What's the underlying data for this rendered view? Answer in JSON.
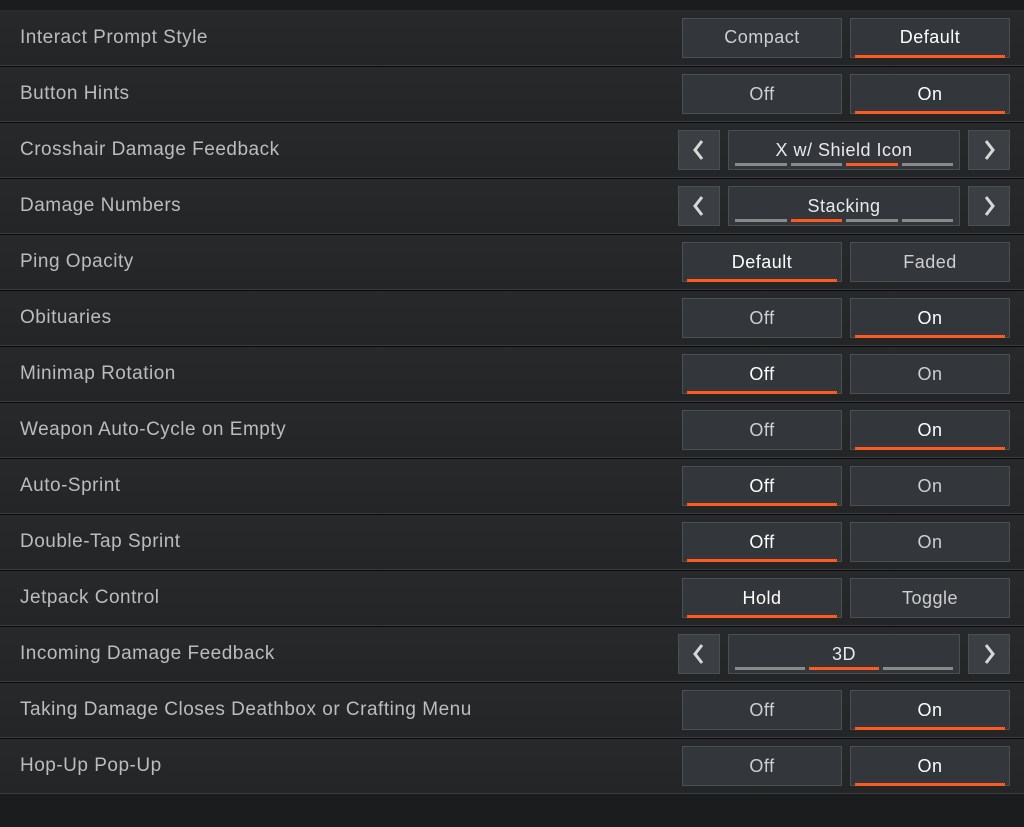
{
  "settings": [
    {
      "id": "interact-prompt-style",
      "label": "Interact Prompt Style",
      "type": "toggle2",
      "options": [
        "Compact",
        "Default"
      ],
      "selected": 1
    },
    {
      "id": "button-hints",
      "label": "Button Hints",
      "type": "toggle2",
      "options": [
        "Off",
        "On"
      ],
      "selected": 1
    },
    {
      "id": "crosshair-damage-feedback",
      "label": "Crosshair Damage Feedback",
      "type": "carousel",
      "value": "X w/ Shield Icon",
      "count": 4,
      "index": 2
    },
    {
      "id": "damage-numbers",
      "label": "Damage Numbers",
      "type": "carousel",
      "value": "Stacking",
      "count": 4,
      "index": 1
    },
    {
      "id": "ping-opacity",
      "label": "Ping Opacity",
      "type": "toggle2",
      "options": [
        "Default",
        "Faded"
      ],
      "selected": 0
    },
    {
      "id": "obituaries",
      "label": "Obituaries",
      "type": "toggle2",
      "options": [
        "Off",
        "On"
      ],
      "selected": 1
    },
    {
      "id": "minimap-rotation",
      "label": "Minimap Rotation",
      "type": "toggle2",
      "options": [
        "Off",
        "On"
      ],
      "selected": 0
    },
    {
      "id": "weapon-auto-cycle",
      "label": "Weapon Auto-Cycle on Empty",
      "type": "toggle2",
      "options": [
        "Off",
        "On"
      ],
      "selected": 1
    },
    {
      "id": "auto-sprint",
      "label": "Auto-Sprint",
      "type": "toggle2",
      "options": [
        "Off",
        "On"
      ],
      "selected": 0
    },
    {
      "id": "double-tap-sprint",
      "label": "Double-Tap Sprint",
      "type": "toggle2",
      "options": [
        "Off",
        "On"
      ],
      "selected": 0
    },
    {
      "id": "jetpack-control",
      "label": "Jetpack Control",
      "type": "toggle2",
      "options": [
        "Hold",
        "Toggle"
      ],
      "selected": 0
    },
    {
      "id": "incoming-damage-feedback",
      "label": "Incoming Damage Feedback",
      "type": "carousel",
      "value": "3D",
      "count": 3,
      "index": 1
    },
    {
      "id": "taking-damage-closes",
      "label": "Taking Damage Closes Deathbox or Crafting Menu",
      "type": "toggle2",
      "options": [
        "Off",
        "On"
      ],
      "selected": 1
    },
    {
      "id": "hop-up-pop-up",
      "label": "Hop-Up Pop-Up",
      "type": "toggle2",
      "options": [
        "Off",
        "On"
      ],
      "selected": 1
    }
  ]
}
